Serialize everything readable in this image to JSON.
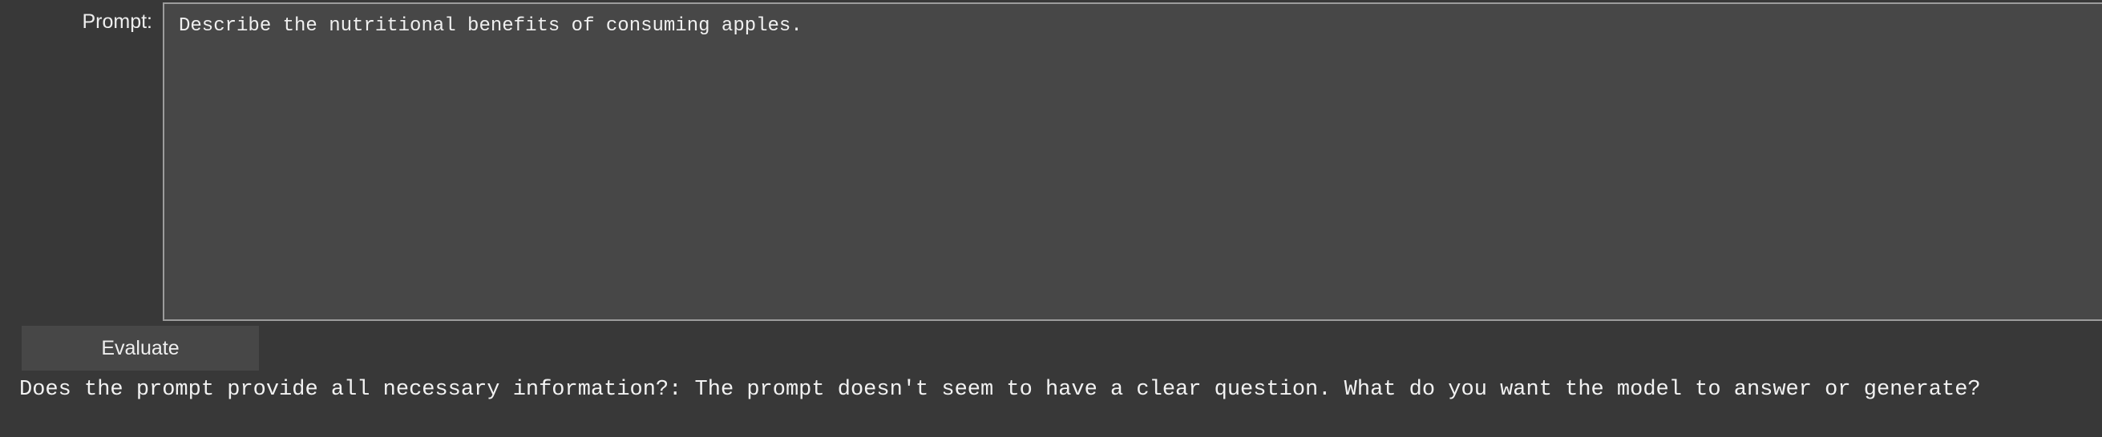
{
  "form": {
    "prompt_label": "Prompt:",
    "prompt_value": "Describe the nutritional benefits of consuming apples."
  },
  "actions": {
    "evaluate_label": "Evaluate"
  },
  "result": {
    "text": "Does the prompt provide all necessary information?: The prompt doesn't seem to have a clear question. What do you want the model to answer or generate?"
  },
  "colors": {
    "background": "#383838",
    "field_background": "#474747",
    "field_border": "#9c9c9c",
    "text": "#f0f0f0"
  }
}
